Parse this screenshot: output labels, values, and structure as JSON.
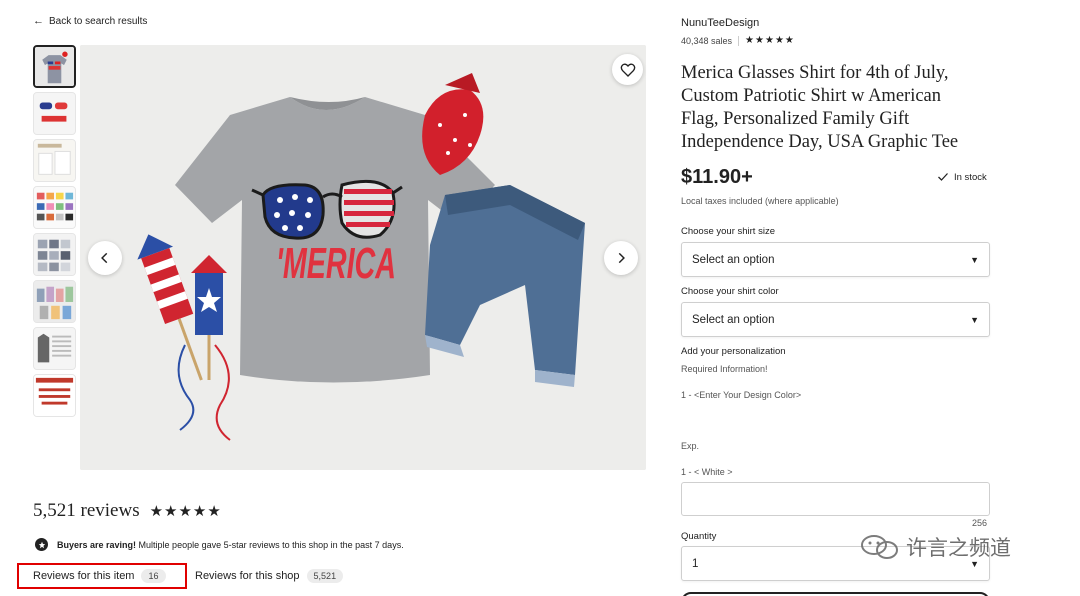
{
  "nav": {
    "back_label": "Back to search results"
  },
  "gallery": {
    "thumbnail_count": 8,
    "main_graphic_text": "'MERICA"
  },
  "shop": {
    "name": "NunuTeeDesign",
    "sales": "40,348 sales",
    "rating_stars": "★★★★★"
  },
  "product": {
    "title": "Merica Glasses Shirt for 4th of July, Custom Patriotic Shirt w American Flag, Personalized Family Gift Independence Day, USA Graphic Tee",
    "price": "$11.90+",
    "stock": "In stock",
    "tax_note": "Local taxes included (where applicable)"
  },
  "options": {
    "size_label": "Choose your shirt size",
    "size_value": "Select an option",
    "color_label": "Choose your shirt color",
    "color_value": "Select an option"
  },
  "personalization": {
    "label": "Add your personalization",
    "required": "Required Information!",
    "line1": "1 - <Enter Your Design Color>",
    "example_label": "Exp.",
    "example_line": "1 - < White >",
    "value": "",
    "char_remaining": "256"
  },
  "quantity": {
    "label": "Quantity",
    "value": "1"
  },
  "reviews": {
    "count_label": "5,521 reviews",
    "stars": "★★★★★",
    "raving_bold": "Buyers are raving!",
    "raving_text": " Multiple people gave 5-star reviews to this shop in the past 7 days.",
    "tabs": [
      {
        "label": "Reviews for this item",
        "count": "16"
      },
      {
        "label": "Reviews for this shop",
        "count": "5,521"
      }
    ]
  },
  "watermark": {
    "text": "许言之频道"
  },
  "colors": {
    "highlight_box": "#e00000",
    "text": "#222222"
  }
}
